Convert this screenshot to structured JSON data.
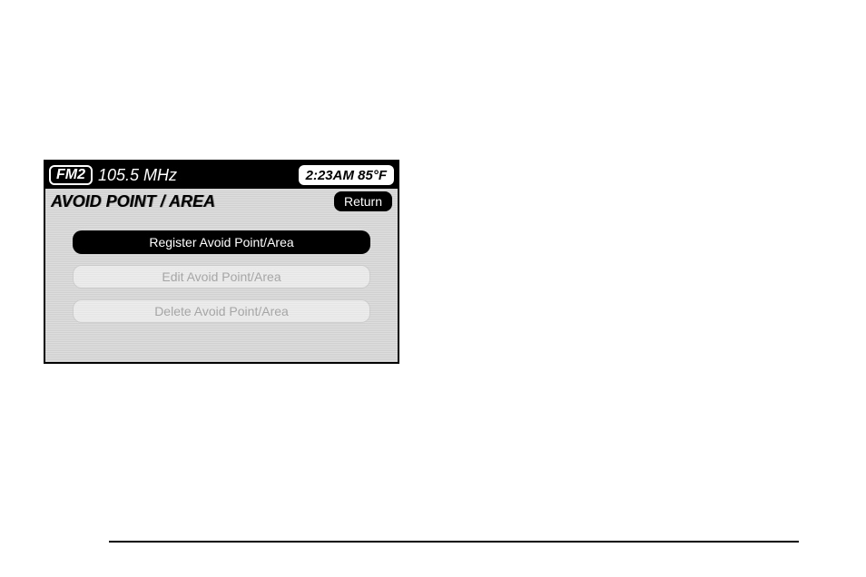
{
  "status": {
    "band": "FM2",
    "frequency": "105.5 MHz",
    "clock": "2:23AM 85°F"
  },
  "titlebar": {
    "title": "AVOID POINT / AREA",
    "return_label": "Return"
  },
  "menu": {
    "items": [
      {
        "label": "Register Avoid Point/Area",
        "active": true
      },
      {
        "label": "Edit Avoid Point/Area",
        "active": false
      },
      {
        "label": "Delete Avoid Point/Area",
        "active": false
      }
    ]
  }
}
